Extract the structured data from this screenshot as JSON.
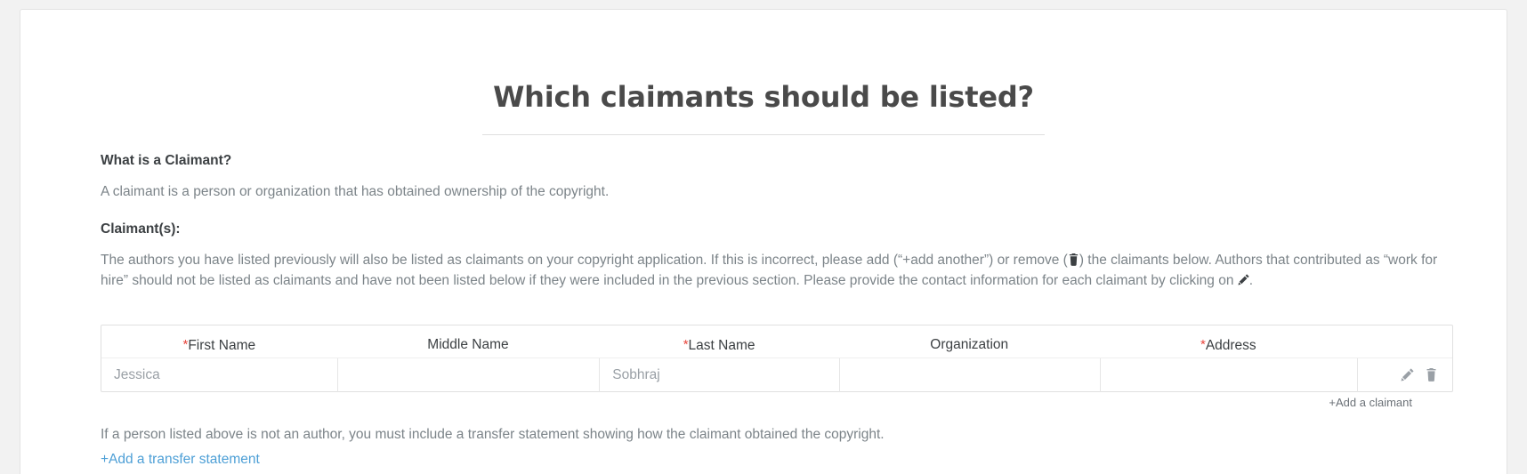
{
  "page": {
    "title": "Which claimants should be listed?"
  },
  "info": {
    "what_is_heading": "What is a Claimant?",
    "what_is_text": "A claimant is a person or organization that has obtained ownership of the copyright.",
    "claimants_heading": "Claimant(s):",
    "instructions_part1": "The authors you have listed previously will also be listed as claimants on your copyright application. If this is incorrect, please add (“+add another”) or remove (",
    "instructions_part2": ") the claimants below. Authors that contributed as “work for hire” should not be listed as claimants and have not been listed below if they were included in the previous section. Please provide the contact information for each claimant by clicking on ",
    "instructions_part3": ".",
    "trash_icon": "trash-icon",
    "pencil_icon": "pencil-icon"
  },
  "table": {
    "columns": [
      {
        "label": "First Name",
        "required": true
      },
      {
        "label": "Middle Name",
        "required": false
      },
      {
        "label": "Last Name",
        "required": true
      },
      {
        "label": "Organization",
        "required": false
      },
      {
        "label": "Address",
        "required": true
      }
    ],
    "required_marker": "*",
    "rows": [
      {
        "first_name": "Jessica",
        "middle_name": "",
        "last_name": "Sobhraj",
        "organization": "",
        "address": "",
        "edit_icon": "pencil-icon",
        "delete_icon": "trash-icon"
      }
    ],
    "add_claimant_label": "+Add a claimant"
  },
  "footer": {
    "transfer_note": "If a person listed above is not an author, you must include a transfer statement showing how the claimant obtained the copyright.",
    "add_transfer_label": "+Add a transfer statement"
  },
  "colors": {
    "required_red": "#e8453c",
    "link_blue": "#4d9fd6",
    "body_gray": "#7c8489",
    "heading_dark": "#3c4043"
  }
}
